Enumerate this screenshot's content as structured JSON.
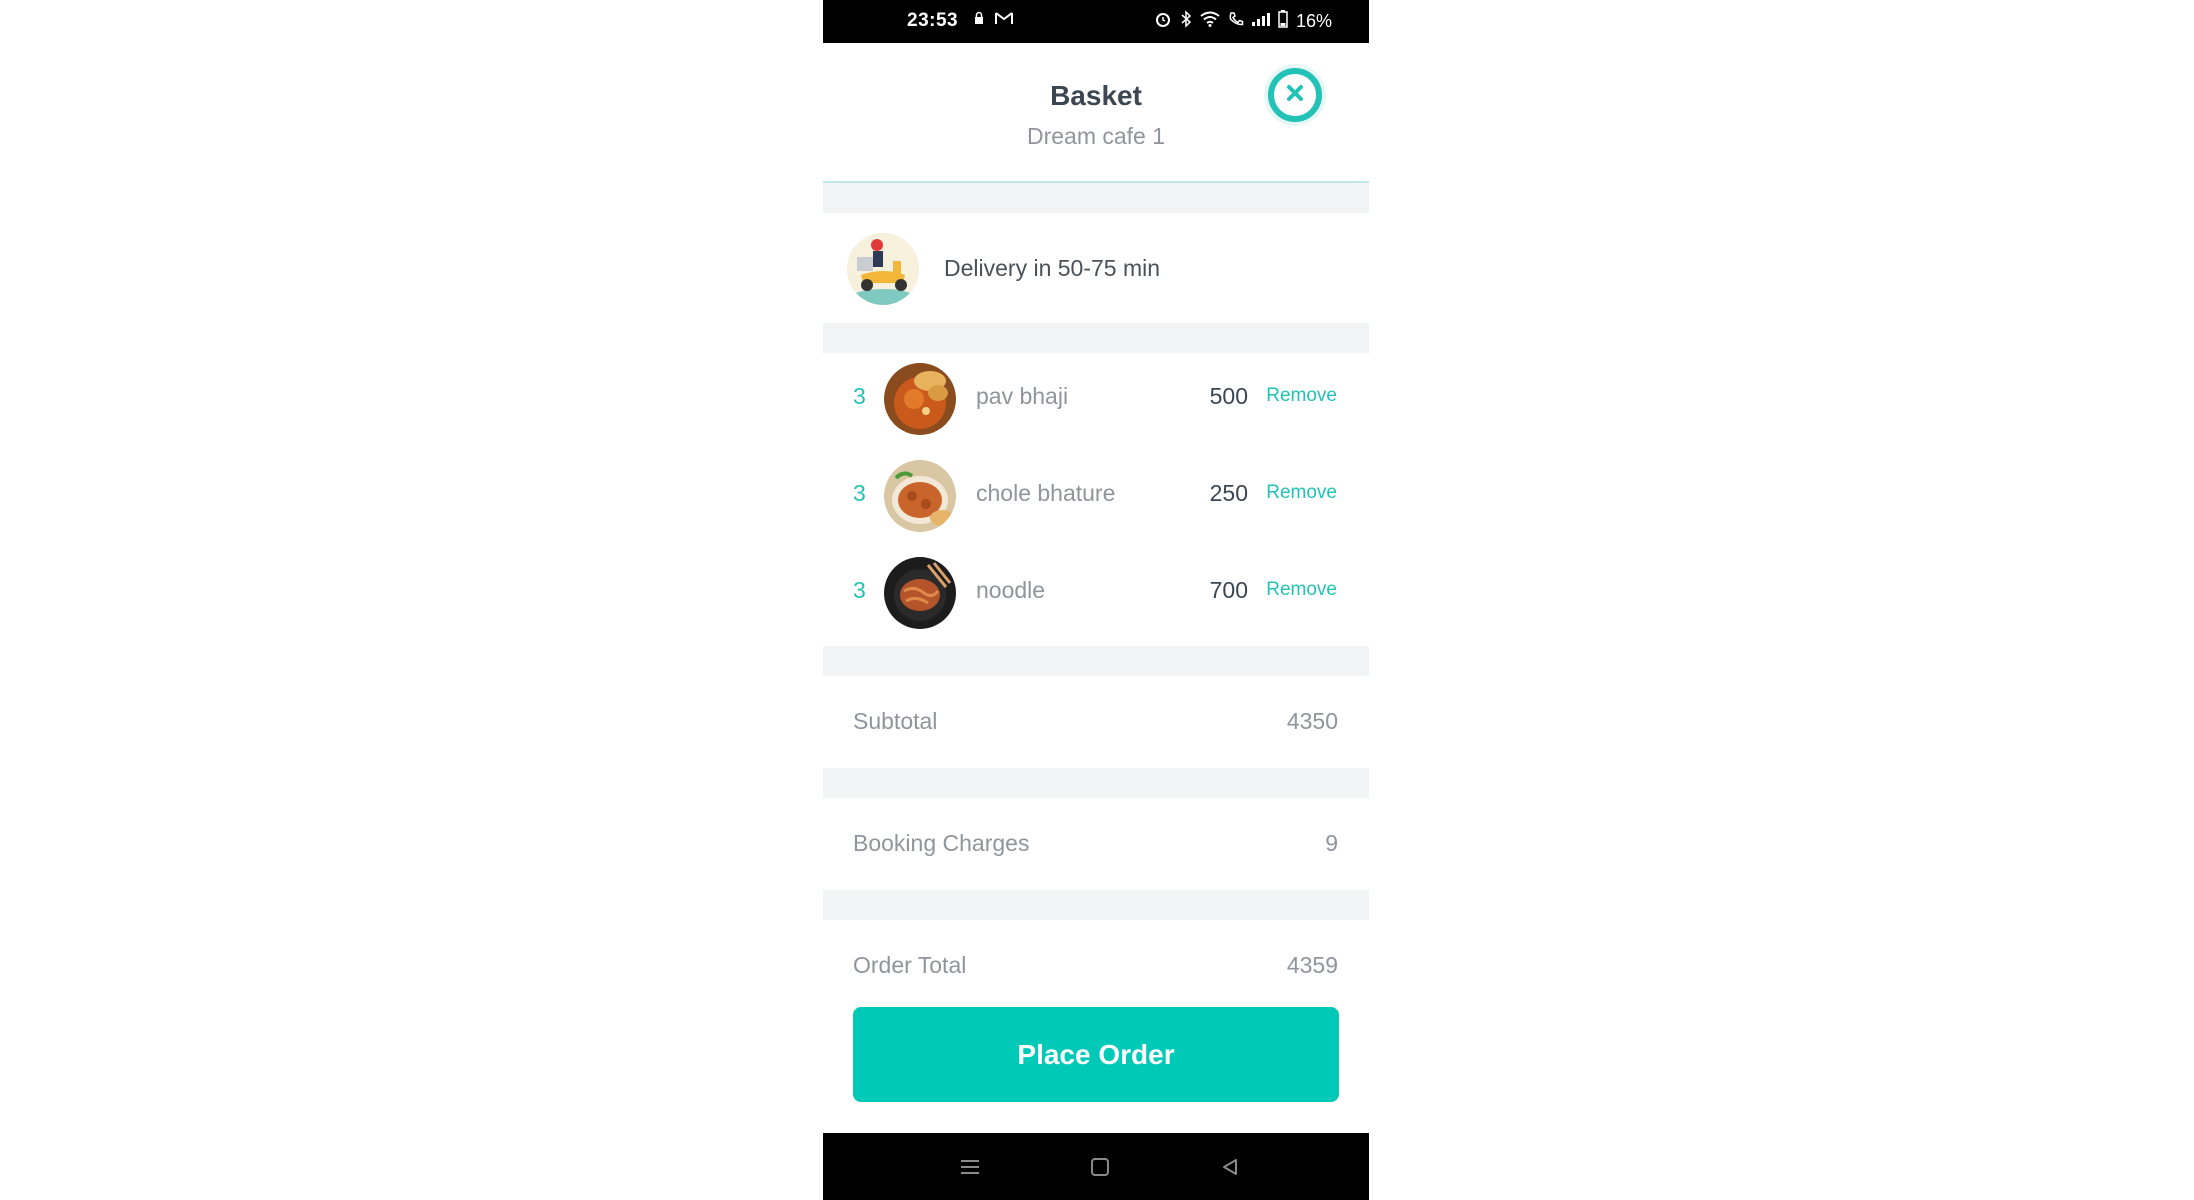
{
  "status_bar": {
    "time": "23:53",
    "battery": "16%",
    "icons_left": [
      "lock-icon",
      "gmail-icon"
    ],
    "icons_right": [
      "alarm-icon",
      "bluetooth-icon",
      "wifi-icon",
      "call-icon",
      "signal-icon",
      "battery-icon"
    ]
  },
  "header": {
    "title": "Basket",
    "subtitle": "Dream cafe 1",
    "close_icon": "close-icon"
  },
  "delivery": {
    "text": "Delivery in 50-75 min",
    "icon": "delivery-scooter-icon"
  },
  "items": [
    {
      "qty": "3",
      "name": "pav bhaji",
      "price": "500",
      "action": "Remove"
    },
    {
      "qty": "3",
      "name": "chole bhature",
      "price": "250",
      "action": "Remove"
    },
    {
      "qty": "3",
      "name": "noodle",
      "price": "700",
      "action": "Remove"
    }
  ],
  "summary": {
    "subtotal_label": "Subtotal",
    "subtotal_value": "4350",
    "booking_label": "Booking Charges",
    "booking_value": "9",
    "total_label": "Order Total",
    "total_value": "4359"
  },
  "cta": {
    "place_order": "Place Order"
  },
  "colors": {
    "accent": "#00c9b7",
    "text_dark": "#3c4650",
    "text_muted": "#8f959b",
    "section_gap": "#f2f3f4"
  },
  "nav_bar": [
    "menu-icon",
    "home-square-icon",
    "back-triangle-icon"
  ]
}
